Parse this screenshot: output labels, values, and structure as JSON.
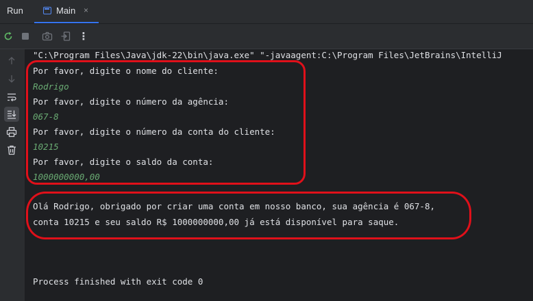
{
  "tool_window": {
    "title": "Run"
  },
  "tab": {
    "label": "Main",
    "close": "×"
  },
  "toolbar": {
    "buttons": [
      {
        "icon": "rerun-icon"
      },
      {
        "icon": "stop-icon"
      },
      {
        "icon": "camera-icon"
      },
      {
        "icon": "exit-icon"
      },
      {
        "icon": "more-icon",
        "label": "⋮"
      }
    ]
  },
  "gutter": {
    "buttons": [
      {
        "icon": "arrow-up-icon"
      },
      {
        "icon": "arrow-down-icon"
      },
      {
        "icon": "soft-wrap-icon"
      },
      {
        "icon": "scroll-to-end-icon"
      },
      {
        "icon": "print-icon"
      },
      {
        "icon": "trash-icon"
      }
    ]
  },
  "console": {
    "command": "\"C:\\Program Files\\Java\\jdk-22\\bin\\java.exe\" \"-javaagent:C:\\Program Files\\JetBrains\\IntelliJ",
    "lines": [
      "Por favor, digite o nome do cliente:",
      "Rodrigo",
      "Por favor, digite o número da agência:",
      "067-8",
      "Por favor, digite o número da conta do cliente:",
      "10215",
      "Por favor, digite o saldo da conta:",
      "1000000000,00"
    ],
    "result": [
      "Olá Rodrigo, obrigado por criar uma conta em nosso banco, sua agência é 067-8,",
      "conta 10215 e seu saldo R$ 1000000000,00 já está disponível para saque."
    ],
    "exit": "Process finished with exit code 0"
  },
  "colors": {
    "background": "#1e1f22",
    "panel": "#2b2d30",
    "text": "#dfe1e5",
    "user_input": "#6aab73",
    "annotation": "#e0101a",
    "accent": "#3574f0"
  }
}
